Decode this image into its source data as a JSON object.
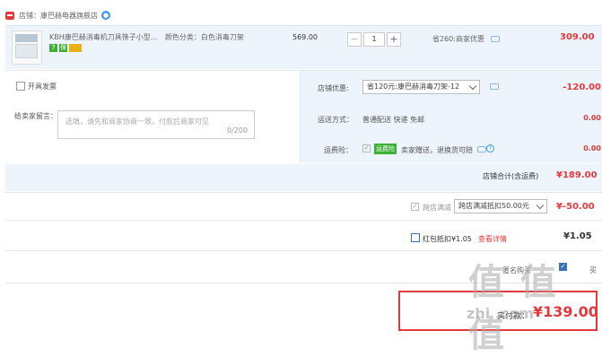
{
  "store": {
    "label": "店铺：康巴赫电器旗舰店"
  },
  "item": {
    "title": "KBH康巴赫消毒机刀具筷子小型...",
    "variant": "颜色分类：白色消毒刀架",
    "unit_price": "569.00",
    "quantity": "1",
    "minus": "−",
    "plus": "+",
    "save_text": "省260:商家优惠",
    "total": "309.00",
    "badges": [
      "7",
      "保",
      ""
    ]
  },
  "invoice": {
    "label": "开具发票"
  },
  "note": {
    "label": "给卖家留言：",
    "placeholder": "选填，请先和商家协商一致，付款后商家可见",
    "count": "0/200"
  },
  "shop_discount": {
    "label": "店铺优惠:",
    "selected": "省120元:康巴赫消毒刀架-12",
    "amount": "-120.00"
  },
  "shipping": {
    "label": "运送方式：",
    "value": "普通配送 快递 免邮",
    "amount": "0.00"
  },
  "insurance": {
    "label": "运费险：",
    "badge": "运费险",
    "text": "卖家赠送，退换货可赔",
    "amount": "0.00"
  },
  "subtotal": {
    "label": "店铺合计(含运费)",
    "amount": "¥189.00"
  },
  "cross_store": {
    "label": "跨店满减",
    "selected": "跨店满减抵扣50.00元",
    "amount": "¥-50.00"
  },
  "red_packet": {
    "label": "红包抵扣¥1.05",
    "link": "查看详情",
    "amount": "¥1.05"
  },
  "footer": {
    "partial1": "匿名购买",
    "partial2": "买"
  },
  "final": {
    "label": "实付款：",
    "amount": "¥139.00"
  },
  "watermark": {
    "big": "值 值 值",
    "small": "zhi  .com"
  },
  "colors": {
    "accent": "#e4393c",
    "panel": "#eef4fb",
    "link": "#3d9be9",
    "green": "#3cb034"
  }
}
